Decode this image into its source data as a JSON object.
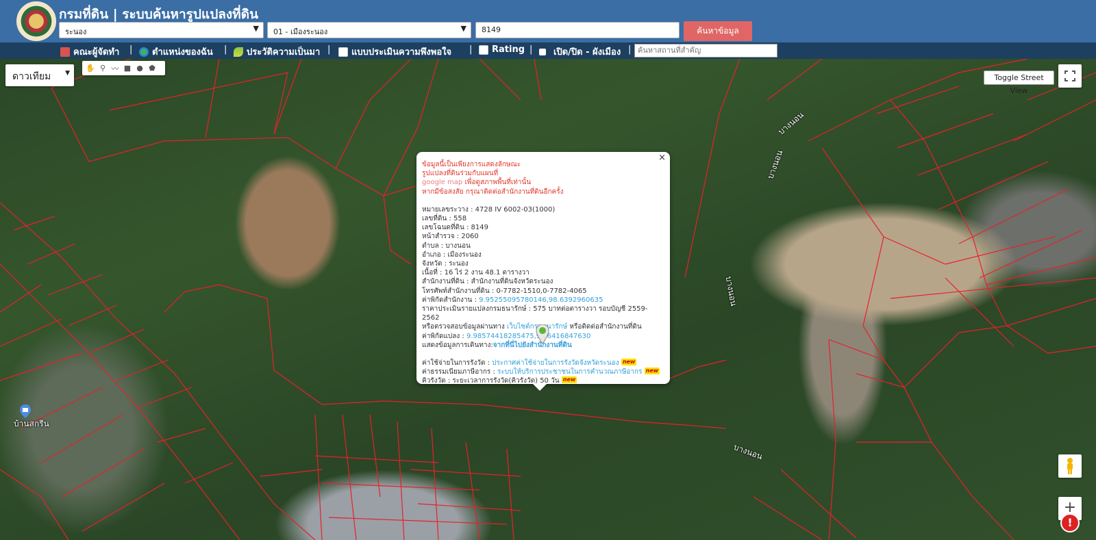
{
  "header": {
    "title": "กรมที่ดิน | ระบบค้นหารูปแปลงที่ดิน",
    "province_value": "ระนอง",
    "amphoe_value": "01 - เมืองระนอง",
    "deed_value": "8149",
    "search_label": "ค้นหาข้อมูล"
  },
  "nav": {
    "items": [
      {
        "label": "คณะผู้จัดทำ"
      },
      {
        "label": "ตำแหน่งของฉัน"
      },
      {
        "label": "ประวัติความเป็นมา"
      },
      {
        "label": "แบบประเมินความพึงพอใจ"
      },
      {
        "label": "Rating"
      },
      {
        "label": "เปิด/ปิด - ผังเมือง"
      }
    ],
    "place_placeholder": "ค้นหาสถานที่สำคัญ"
  },
  "map": {
    "type_label": "ดาวเทียม",
    "street_view_label": "Toggle Street View",
    "road_labels": [
      "บางนอน",
      "บางนอน",
      "บางนอน",
      "บางนอน"
    ],
    "poi_label": "บ้านสกรีน"
  },
  "info": {
    "notice": [
      "ข้อมูลนี้เป็นเพียงการแสดงลักษณะ",
      "รูปแปลงที่ดินร่วมกับแผนที่",
      "google map",
      "เพื่อดูสภาพพื้นที่เท่านั้น",
      "หากมีข้อสงสัย กรุณาติดต่อสำนักงานที่ดินอีกครั้ง"
    ],
    "map_sheet": "หมายเลขระวาง : 4728 IV 6002-03(1000)",
    "land_no": "เลขที่ดิน : 558",
    "deed_no": "เลขโฉนดที่ดิน : 8149",
    "survey_page": "หน้าสำรวจ : 2060",
    "tambon": "ตำบล : บางนอน",
    "amphoe": "อำเภอ : เมืองระนอง",
    "province": "จังหวัด : ระนอง",
    "area": "เนื้อที่ : 16 ไร่ 2 งาน 48.1 ตารางวา",
    "office": "สำนักงานที่ดิน : สำนักงานที่ดินจังหวัดระนอง",
    "office_phone": "โทรศัพท์สำนักงานที่ดิน : 0-7782-1510,0-7782-4065",
    "office_coord_label": "ค่าพิกัดสำนักงาน :",
    "office_coord": "9.95255095780146,98.6392960635",
    "price": "ราคาประเมินรายแปลงกรมธนารักษ์ : 575 บาทต่อตารางวา รอบบัญชี 2559-2562",
    "price_check_pre": "หรือตรวจสอบข้อมูลผ่านทาง",
    "price_check_link": "เว็บไซต์กรมธนารักษ์",
    "price_check_post": "หรือติดต่อสำนักงานที่ดิน",
    "parcel_coord_label": "ค่าพิกัดแปลง :",
    "parcel_coord": "9.98574418285475,98.6416847630",
    "route_label": "แสดงข้อมูลการเดินทาง:",
    "route_link": "จากที่นี่ไปยังสำนักงานที่ดิน",
    "fee_label": "ค่าใช้จ่ายในการรังวัด :",
    "fee_link": "ประกาศค่าใช้จ่ายในการรังวัดจังหวัดระนอง",
    "tax_label": "ค่าธรรมเนียมภาษีอากร :",
    "tax_link": "ระบบให้บริการประชาชนในการคำนวณภาษีอากร",
    "queue": "คิวรังวัด : ระยะเวลาการรังวัด(คิวรังวัด) 50 วัน",
    "new_tag": "new",
    "close": "×"
  },
  "colors": {
    "header": "#3a6ea5",
    "nav": "#1d3f60",
    "search_button": "#e06666",
    "parcel_line": "#e8202a",
    "warn_text": "#e0372b",
    "link": "#35a0d9"
  }
}
